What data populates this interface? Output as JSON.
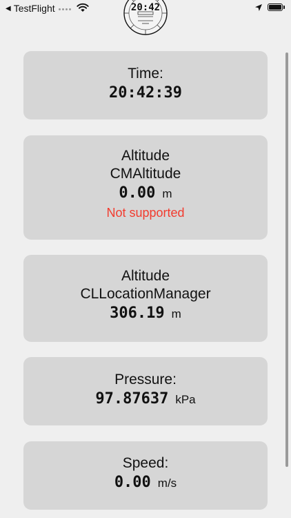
{
  "status_bar": {
    "back_label": "TestFlight",
    "clock": "20:42"
  },
  "cards": {
    "time": {
      "label": "Time:",
      "value": "20:42:39"
    },
    "cm_altitude": {
      "label_line1": "Altitude",
      "label_line2": "CMAltitude",
      "value": "0.00",
      "unit": "m",
      "status": "Not supported"
    },
    "cl_altitude": {
      "label_line1": "Altitude",
      "label_line2": "CLLocationManager",
      "value": "306.19",
      "unit": "m"
    },
    "pressure": {
      "label": "Pressure:",
      "value": "97.87637",
      "unit": "kPa"
    },
    "speed": {
      "label": "Speed:",
      "value": "0.00",
      "unit": "m/s"
    }
  },
  "colors": {
    "background": "#efefef",
    "card": "#d6d6d6",
    "error": "#f23b2e"
  },
  "icons": [
    "back-arrow-icon",
    "wifi-icon",
    "location-arrow-icon",
    "battery-icon",
    "compass-icon"
  ]
}
